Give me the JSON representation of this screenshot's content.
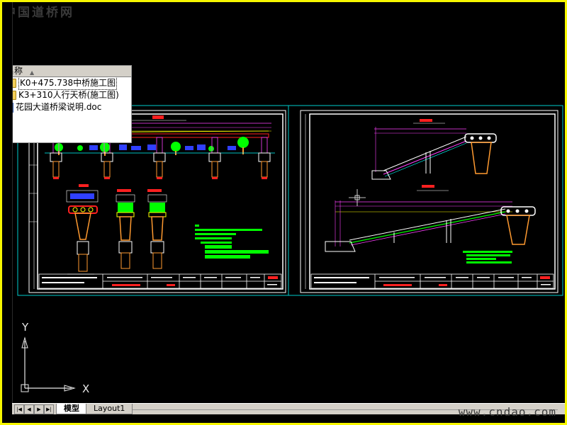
{
  "watermark": {
    "top_text": "中国道桥网",
    "bottom_text": "www.cndao.com"
  },
  "file_panel": {
    "header": "名称",
    "items": [
      {
        "name": "K0+475.738中桥施工图",
        "icon": "folder-icon",
        "selected": true
      },
      {
        "name": "K3+310人行天桥(施工图)",
        "icon": "folder-icon",
        "selected": false
      },
      {
        "name": "花园大道桥梁说明.doc",
        "icon": "word-doc-icon",
        "selected": false
      }
    ]
  },
  "ucs": {
    "x_label": "X",
    "y_label": "Y"
  },
  "tabs": {
    "model": "模型",
    "layout1": "Layout1",
    "active": "模型"
  },
  "colors": {
    "background": "#000000",
    "frame": "#f7f700",
    "sheet_border": "#ffffff",
    "viewport_border": "#00cccc",
    "red": "#ff2020",
    "magenta": "#ff40ff",
    "green": "#00ff00",
    "yellow": "#ffff00",
    "cyan": "#00ffff",
    "blue": "#3040ff",
    "orange": "#ff9a30"
  }
}
